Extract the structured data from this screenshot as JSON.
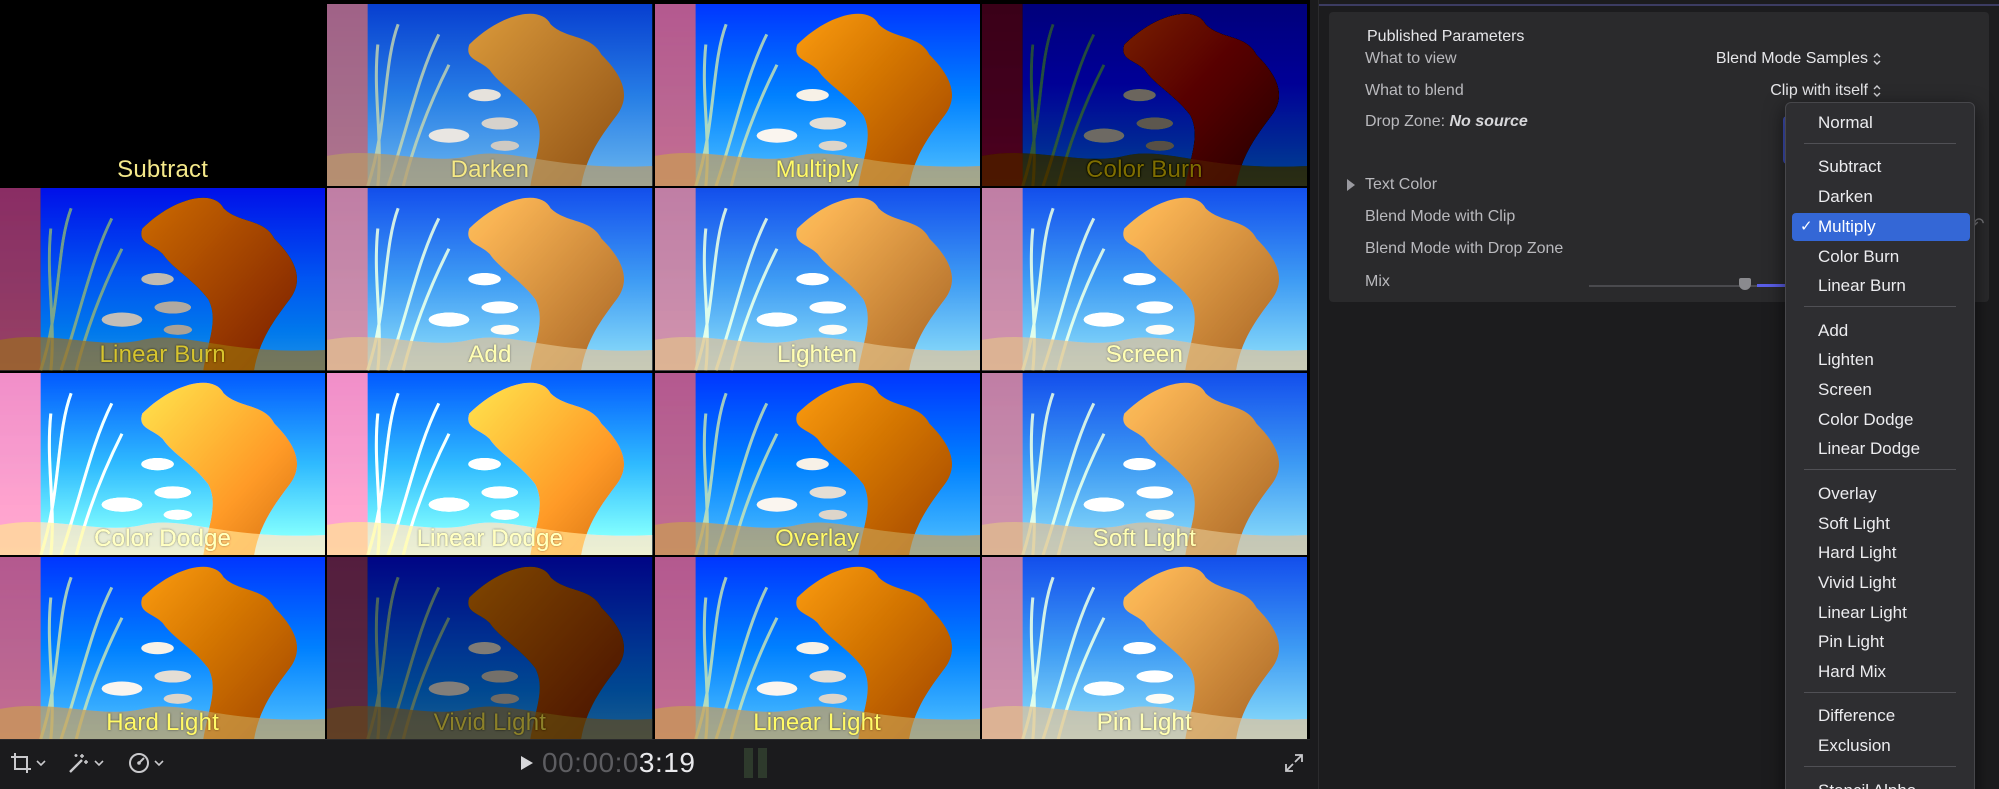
{
  "viewer": {
    "tiles": [
      {
        "label": "Subtract",
        "variant": "subtract"
      },
      {
        "label": "Darken",
        "variant": "normal"
      },
      {
        "label": "Multiply",
        "variant": "rich"
      },
      {
        "label": "Color Burn",
        "variant": "burn"
      },
      {
        "label": "Linear Burn",
        "variant": "deep"
      },
      {
        "label": "Add",
        "variant": "bright"
      },
      {
        "label": "Lighten",
        "variant": "bright"
      },
      {
        "label": "Screen",
        "variant": "bright"
      },
      {
        "label": "Color Dodge",
        "variant": "dodge"
      },
      {
        "label": "Linear Dodge",
        "variant": "dodge"
      },
      {
        "label": "Overlay",
        "variant": "rich"
      },
      {
        "label": "Soft Light",
        "variant": "bright"
      },
      {
        "label": "Hard Light",
        "variant": "rich"
      },
      {
        "label": "Vivid Light",
        "variant": "darken"
      },
      {
        "label": "Linear Light",
        "variant": "rich"
      },
      {
        "label": "Pin Light",
        "variant": "bright"
      }
    ]
  },
  "toolbar": {
    "timecode_dim": "00:00:0",
    "timecode_bright": "3:19"
  },
  "inspector": {
    "section_title": "Published Parameters",
    "what_to_view": {
      "label": "What to view",
      "value": "Blend Mode Samples"
    },
    "what_to_blend": {
      "label": "What to blend",
      "value": "Clip with itself"
    },
    "drop_zone": {
      "label": "Drop Zone:",
      "value": "No source"
    },
    "text_color": {
      "label": "Text Color"
    },
    "blend_with_clip": {
      "label": "Blend Mode with Clip"
    },
    "blend_with_drop_zone": {
      "label": "Blend Mode with Drop Zone"
    },
    "mix": {
      "label": "Mix"
    }
  },
  "popup": {
    "selected": "Multiply",
    "items": [
      "Normal",
      "Subtract",
      "Darken",
      "Multiply",
      "Color Burn",
      "Linear Burn",
      "Add",
      "Lighten",
      "Screen",
      "Color Dodge",
      "Linear Dodge",
      "Overlay",
      "Soft Light",
      "Hard Light",
      "Vivid Light",
      "Linear Light",
      "Pin Light",
      "Hard Mix",
      "Difference",
      "Exclusion",
      "Stencil Alpha"
    ]
  },
  "colors": {
    "label_yellow": "#f5e98a",
    "selection_blue": "#3467d6",
    "water_blue": "#1f6fd6",
    "coral_orange": "#c8862e"
  }
}
